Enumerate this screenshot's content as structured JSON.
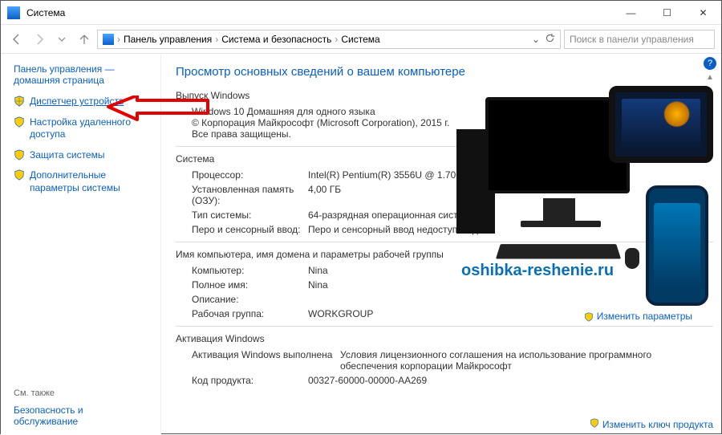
{
  "window": {
    "title": "Система"
  },
  "breadcrumb": {
    "items": [
      "Панель управления",
      "Система и безопасность",
      "Система"
    ]
  },
  "search": {
    "placeholder": "Поиск в панели управления"
  },
  "sidebar": {
    "home": "Панель управления — домашняя страница",
    "items": [
      {
        "label": "Диспетчер устройств"
      },
      {
        "label": "Настройка удаленного доступа"
      },
      {
        "label": "Защита системы"
      },
      {
        "label": "Дополнительные параметры системы"
      }
    ],
    "see_also_hdr": "См. также",
    "see_also_link": "Безопасность и обслуживание"
  },
  "main": {
    "heading": "Просмотр основных сведений о вашем компьютере",
    "edition_hdr": "Выпуск Windows",
    "edition_name": "Windows 10 Домашняя для одного языка",
    "copyright": "© Корпорация Майкрософт (Microsoft Corporation), 2015 г. Все права защищены.",
    "system_hdr": "Система",
    "cpu_k": "Процессор:",
    "cpu_v": "Intel(R) Pentium(R) 3556U @ 1.70GHz  1",
    "ram_k": "Установленная память (ОЗУ):",
    "ram_v": "4,00 ГБ",
    "type_k": "Тип системы:",
    "type_v": "64-разрядная операционная система,",
    "pen_k": "Перо и сенсорный ввод:",
    "pen_v": "Перо и сенсорный ввод недоступны д",
    "name_hdr": "Имя компьютера, имя домена и параметры рабочей группы",
    "comp_k": "Компьютер:",
    "comp_v": "Nina",
    "full_k": "Полное имя:",
    "full_v": "Nina",
    "desc_k": "Описание:",
    "desc_v": "",
    "wg_k": "Рабочая группа:",
    "wg_v": "WORKGROUP",
    "activation_hdr": "Активация Windows",
    "activation_status": "Активация Windows выполнена",
    "activation_link": "Условия лицензионного соглашения на использование программного обеспечения корпорации Майкрософт",
    "pkey_k": "Код продукта:",
    "pkey_v": "00327-60000-00000-AA269",
    "change_params": "Изменить параметры",
    "change_key": "Изменить ключ продукта"
  },
  "watermark": "oshibka-reshenie.ru"
}
